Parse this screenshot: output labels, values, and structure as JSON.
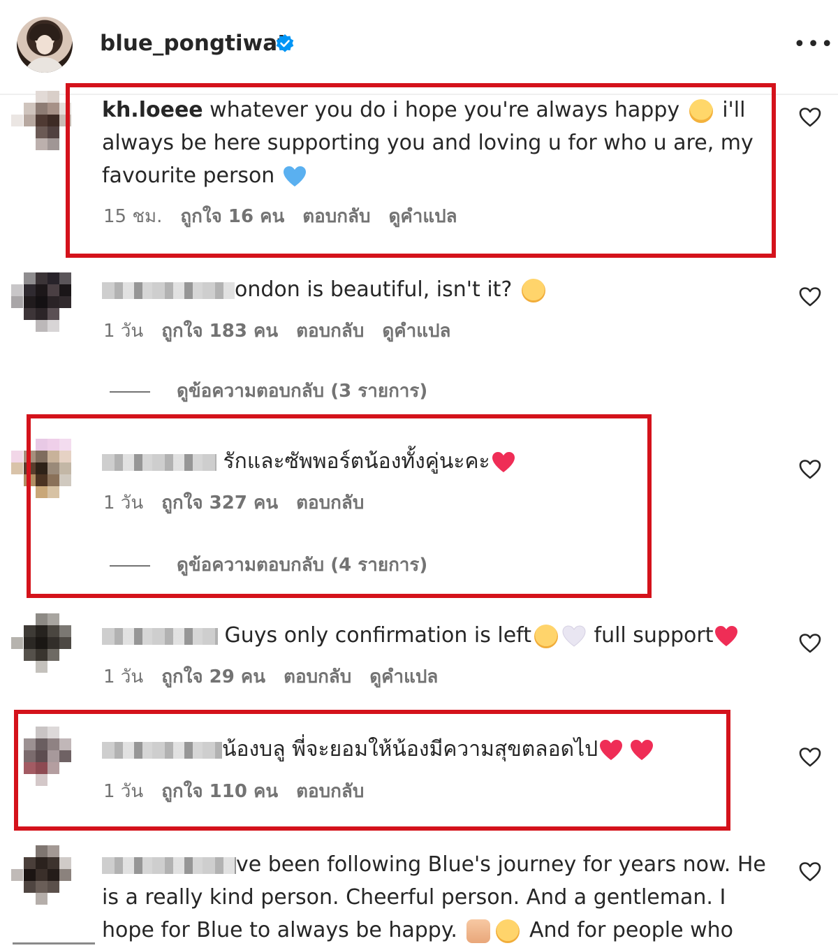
{
  "header": {
    "username": "blue_pongtiwat",
    "verified_icon": "verified-badge-icon",
    "more_icon": "more-options-icon",
    "more_label": "•••"
  },
  "colors": {
    "highlight_box": "#d4121b",
    "meta_text": "#737373",
    "primary_text": "#262626",
    "verified": "#0095f6"
  },
  "comments": [
    {
      "username": "kh.loeee",
      "text_a": " whatever you do i hope you're always happy ",
      "text_b": " i'll always be here supporting you and loving u for who u are, my favourite person ",
      "time": "15 ชม.",
      "likes": "ถูกใจ 16 คน",
      "reply": "ตอบกลับ",
      "translate": "ดูคำแปล",
      "highlighted": true
    },
    {
      "username_partial": "ondon is beautiful, isn't it? ",
      "time": "1 วัน",
      "likes": "ถูกใจ 183 คน",
      "reply": "ตอบกลับ",
      "translate": "ดูคำแปล",
      "view_replies": "ดูข้อความตอบกลับ (3 รายการ)",
      "highlighted": false
    },
    {
      "text": " รักและซัพพอร์ตน้องทั้งคู่นะคะ",
      "time": "1 วัน",
      "likes": "ถูกใจ 327 คน",
      "reply": "ตอบกลับ",
      "view_replies": "ดูข้อความตอบกลับ (4 รายการ)",
      "highlighted": true
    },
    {
      "text_a": " Guys only confirmation is left",
      "text_b": " full support",
      "time": "1 วัน",
      "likes": "ถูกใจ 29 คน",
      "reply": "ตอบกลับ",
      "translate": "ดูคำแปล",
      "highlighted": false
    },
    {
      "text": "น้องบลู พี่จะยอมให้น้องมีความสุขตลอดไป",
      "time": "1 วัน",
      "likes": "ถูกใจ 110 คน",
      "reply": "ตอบกลับ",
      "highlighted": true
    },
    {
      "text_a": "ve been following Blue's journey for years now. He",
      "text_b": "is a really kind person. Cheerful person. And a gentleman. I",
      "text_c": "hope for Blue to always be happy. ",
      "text_d": " And for people who",
      "highlighted": false
    }
  ]
}
